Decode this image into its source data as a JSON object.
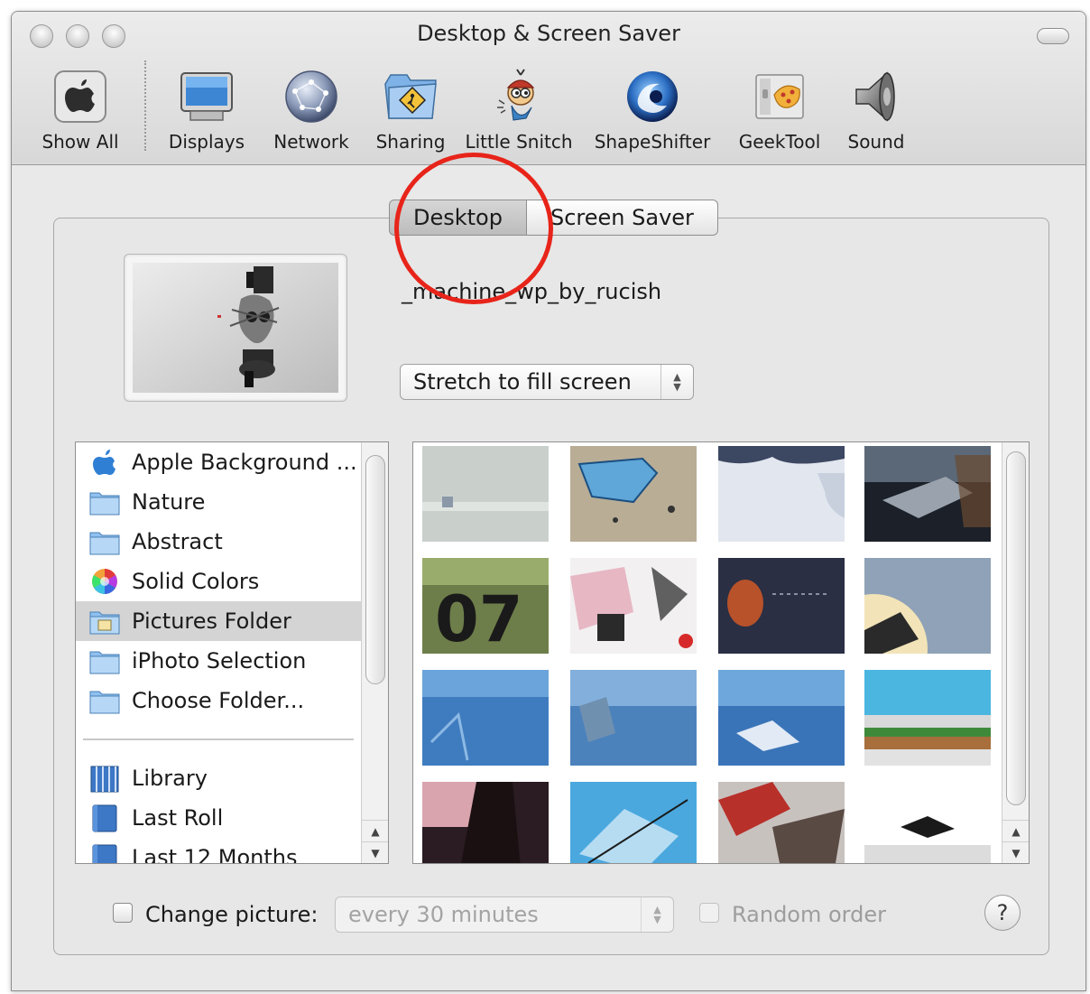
{
  "window": {
    "title": "Desktop & Screen Saver"
  },
  "toolbar": {
    "items": [
      {
        "label": "Show All",
        "icon": "apple-icon"
      },
      {
        "label": "Displays",
        "icon": "display-icon"
      },
      {
        "label": "Network",
        "icon": "network-globe-icon"
      },
      {
        "label": "Sharing",
        "icon": "sharing-folder-icon"
      },
      {
        "label": "Little Snitch",
        "icon": "little-snitch-icon"
      },
      {
        "label": "ShapeShifter",
        "icon": "shapeshifter-icon"
      },
      {
        "label": "GeekTool",
        "icon": "geektool-icon"
      },
      {
        "label": "Sound",
        "icon": "speaker-icon"
      }
    ]
  },
  "tabs": [
    {
      "label": "Desktop",
      "selected": true
    },
    {
      "label": "Screen Saver",
      "selected": false
    }
  ],
  "current_picture": {
    "name": "_machine_wp_by_rucish"
  },
  "fill_mode": {
    "selected": "Stretch to fill screen"
  },
  "sources": {
    "items": [
      {
        "label": "Apple Background ...",
        "icon": "apple-logo-icon",
        "selected": false
      },
      {
        "label": "Nature",
        "icon": "folder-icon",
        "selected": false
      },
      {
        "label": "Abstract",
        "icon": "folder-icon",
        "selected": false
      },
      {
        "label": "Solid Colors",
        "icon": "color-wheel-icon",
        "selected": false
      },
      {
        "label": "Pictures Folder",
        "icon": "pictures-folder-icon",
        "selected": true
      },
      {
        "label": "iPhoto Selection",
        "icon": "folder-icon",
        "selected": false
      },
      {
        "label": "Choose Folder...",
        "icon": "folder-icon",
        "selected": false
      }
    ],
    "iphoto_items": [
      {
        "label": "Library",
        "icon": "iphoto-library-icon"
      },
      {
        "label": "Last Roll",
        "icon": "iphoto-album-icon"
      },
      {
        "label": "Last 12 Months",
        "icon": "iphoto-album-icon"
      }
    ]
  },
  "thumbnails_count": 16,
  "bottom": {
    "change_picture_label": "Change picture:",
    "change_picture_checked": false,
    "interval": "every 30 minutes",
    "random_order_label": "Random order",
    "random_order_checked": false,
    "help_label": "?"
  },
  "colors": {
    "annotation": "#e8241a",
    "selection": "#d4d4d4"
  }
}
